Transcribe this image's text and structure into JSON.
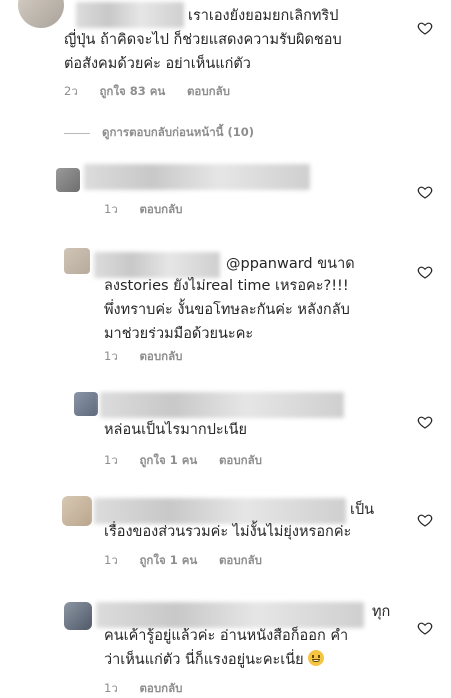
{
  "comments": [
    {
      "lines": [
        "เราเองยังยอมยกเลิกทริป",
        "ญี่ปุ่น ถ้าคิดจะไป ก็ช่วยแสดงความรับผิดชอบ",
        "ต่อสังคมด้วยค่ะ อย่าเห็นแก่ตัว"
      ],
      "time": "2ว",
      "likes": "ถูกใจ 83 คน",
      "reply": "ตอบกลับ"
    },
    {
      "lines": [],
      "time": "1ว",
      "likes": "",
      "reply": "ตอบกลับ"
    },
    {
      "lines": [
        "@ppanward ขนาด",
        "ลงstories ยังไม่real time เหรอคะ?!!!",
        "พึ่งทราบค่ะ งั้นขอโทษละกันค่ะ หลังกลับ",
        "มาช่วยร่วมมือด้วยนะคะ"
      ],
      "time": "1ว",
      "likes": "",
      "reply": "ตอบกลับ"
    },
    {
      "lines": [
        "หล่อนเป็นไรมากปะเนีย"
      ],
      "time": "1ว",
      "likes": "ถูกใจ 1 คน",
      "reply": "ตอบกลับ"
    },
    {
      "lines": [
        "เป็น",
        "เรื่องของส่วนรวมค่ะ ไม่งั้นไม่ยุ่งหรอกค่ะ"
      ],
      "time": "1ว",
      "likes": "ถูกใจ 1 คน",
      "reply": "ตอบกลับ"
    },
    {
      "lines": [
        "ทุก",
        "คนเค้ารู้อยู่แล้วค่ะ อ่านหนังสือก็ออก คำ",
        "ว่าเห็นแก่ตัว นี่ก็แรงอยู่นะคะเนี่ย"
      ],
      "time": "1ว",
      "likes": "",
      "reply": "ตอบกลับ"
    }
  ],
  "view_replies": "ดูการตอบกลับก่อนหน้านี้ (10)",
  "icons": {
    "like": "heart-outline-icon",
    "emoji": "grimacing-face-emoji"
  },
  "colors": {
    "text": "#262626",
    "meta": "#8e8e8e",
    "icon": "#262626"
  }
}
